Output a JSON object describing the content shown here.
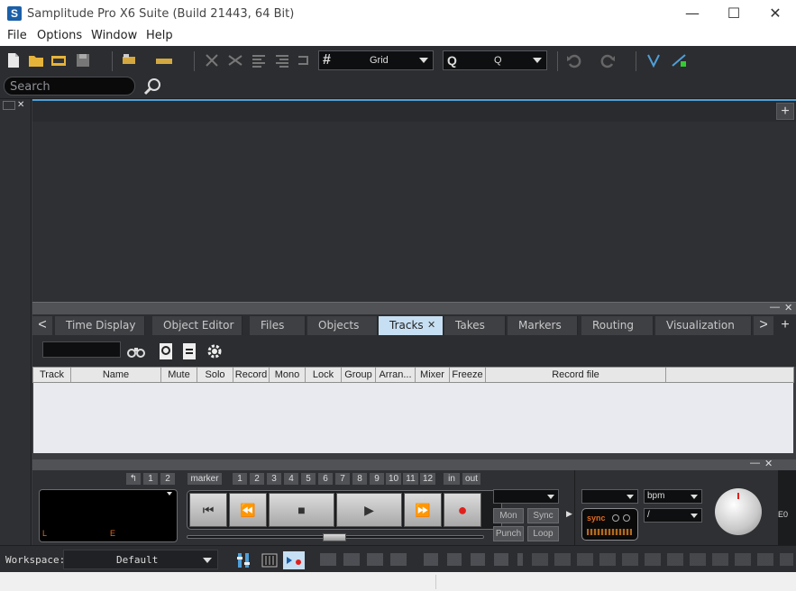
{
  "window": {
    "title": "Samplitude Pro X6 Suite (Build 21443, 64 Bit)",
    "logo_letter": "S",
    "controls": {
      "minimize": "—",
      "maximize": "☐",
      "close": "✕"
    }
  },
  "menu": [
    "File",
    "Options",
    "Window",
    "Help"
  ],
  "toolbar": {
    "grid_label": "Grid",
    "grid_icon": "#",
    "q_icon": "Q",
    "q_label": "Q"
  },
  "search": {
    "placeholder": "Search"
  },
  "arrangement": {
    "add_label": "+"
  },
  "docker": {
    "tabs": [
      "Time Display",
      "Object Editor",
      "Files",
      "Objects",
      "Tracks",
      "Takes",
      "Markers",
      "Routing",
      "Visualization"
    ],
    "active_tab": "Tracks",
    "tab_close": "✕",
    "prev_arrow": "<",
    "next_arrow": ">",
    "add_label": "+",
    "window_buttons": {
      "minimize": "—",
      "close": "✕"
    }
  },
  "tracks_table": {
    "columns": [
      "Track",
      "Name",
      "Mute",
      "Solo",
      "Record",
      "Mono",
      "Lock",
      "Group",
      "Arran...",
      "Mixer",
      "Freeze",
      "Record file"
    ],
    "rows": []
  },
  "transport": {
    "marker_buttons": [
      "↰",
      "1",
      "2"
    ],
    "marker_label": "marker",
    "marker_numbers": [
      "1",
      "2",
      "3",
      "4",
      "5",
      "6",
      "7",
      "8",
      "9",
      "10",
      "11",
      "12"
    ],
    "in_label": "in",
    "out_label": "out",
    "display_left": "L",
    "display_end": "E",
    "buttons": {
      "to_start": "⏮",
      "rewind": "⏪",
      "stop": "■",
      "play": "▶",
      "fast_forward": "⏩",
      "record": "●"
    },
    "mon_label": "Mon",
    "sync_label": "Sync",
    "punch_label": "Punch",
    "loop_label": "Loop",
    "sync_indicator": "sync",
    "bpm_label": "bpm",
    "signature_label": "/",
    "right_readout": "E0"
  },
  "workspace": {
    "label": "Workspace:",
    "value": "Default"
  },
  "colors": {
    "accent": "#4f9fd8",
    "active_tab": "#c7dff2",
    "record": "#e0201c",
    "display_text": "#e06a20"
  }
}
